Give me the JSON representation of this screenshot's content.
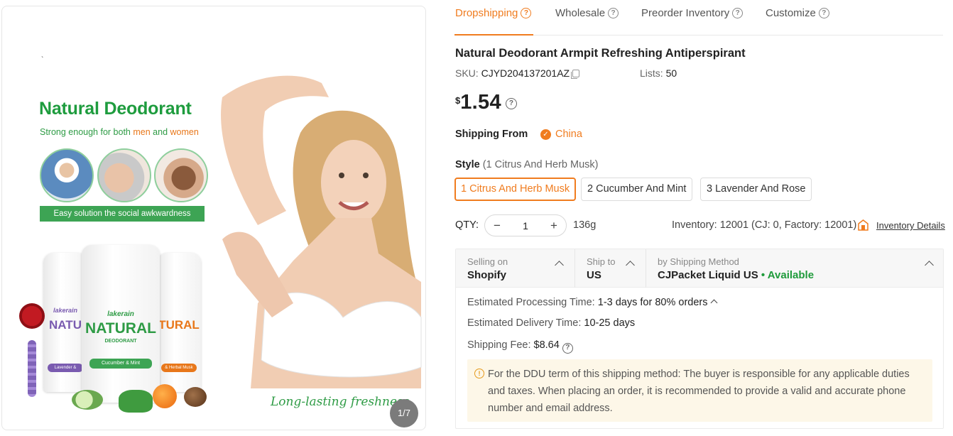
{
  "product_image": {
    "promo_title": "Natural Deodorant",
    "promo_subtitle_prefix": "Strong enough for both ",
    "promo_subtitle_men": "men",
    "promo_subtitle_and": " and ",
    "promo_subtitle_women": "women",
    "promo_banner": "Easy solution the social awkwardness",
    "brand": "lakerain",
    "stick_word": "NATURAL",
    "stick_word_left": "NATU",
    "stick_word_right": "TURAL",
    "stick_sub": "DEODORANT",
    "band_left": "Lavender &",
    "band_center": "Cucumber & Mint",
    "band_right": "& Herbal Musk",
    "tagline": "Long-lasting freshness",
    "pager": "1/7"
  },
  "tabs": [
    {
      "label": "Dropshipping",
      "active": true
    },
    {
      "label": "Wholesale",
      "active": false
    },
    {
      "label": "Preorder Inventory",
      "active": false
    },
    {
      "label": "Customize",
      "active": false
    }
  ],
  "product": {
    "title": "Natural Deodorant Armpit Refreshing Antiperspirant",
    "sku_label": "SKU: ",
    "sku": "CJYD204137201AZ",
    "lists_label": "Lists: ",
    "lists": "50",
    "currency": "$",
    "price": "1.54",
    "shipping_from_label": "Shipping From",
    "shipping_from": "China",
    "style_label": "Style",
    "style_selected": "(1 Citrus And Herb Musk)",
    "style_options": [
      "1 Citrus And Herb Musk",
      "2 Cucumber And Mint",
      "3 Lavender And Rose"
    ],
    "qty_label": "QTY:",
    "qty": "1",
    "weight": "136g",
    "inventory": "Inventory: 12001  (CJ: 0, Factory: 12001)",
    "inventory_link": "Inventory Details"
  },
  "shipping": {
    "selling_on_caption": "Selling on",
    "selling_on": "Shopify",
    "ship_to_caption": "Ship to",
    "ship_to": "US",
    "method_caption": "by Shipping Method",
    "method": "CJPacket Liquid US",
    "availability": "• Available",
    "processing_label": "Estimated Processing Time:",
    "processing": "1-3 days for 80% orders",
    "delivery_label": "Estimated Delivery Time:",
    "delivery": "10-25 days",
    "fee_label": "Shipping Fee:",
    "fee": "$8.64",
    "notice": "For the DDU term of this shipping method: The buyer is responsible for any applicable duties and taxes. When placing an order, it is recommended to provide a valid and accurate phone number and email address."
  },
  "colors": {
    "accent": "#f07c1f",
    "available": "#1f9b3b",
    "promo_green": "#1e9c3e"
  }
}
